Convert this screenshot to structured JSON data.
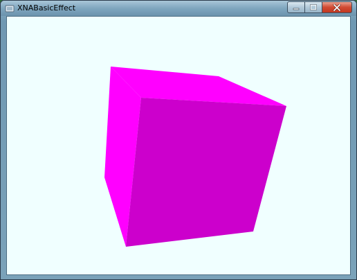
{
  "window": {
    "title": "XNABasicEffect",
    "title_icon": "app-icon",
    "controls": {
      "minimize_icon": "minimize-icon",
      "maximize_icon": "maximize-icon",
      "close_icon": "close-icon"
    }
  },
  "viewport": {
    "background_color": "#F0FFFF",
    "cube": {
      "front_face_color": "#CC00CC",
      "left_face_color": "#FF00FF",
      "top_face_color": "#FF00FF"
    }
  }
}
